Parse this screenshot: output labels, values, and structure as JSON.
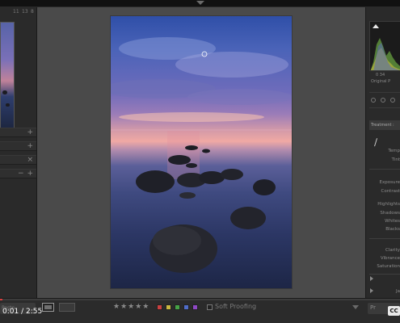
{
  "top_bar": {
    "collapse_icon": "triangle-down-icon"
  },
  "navigator": {
    "zoom_options": [
      "11",
      "13",
      "8"
    ]
  },
  "left_panel": {
    "rows": [
      {
        "action": "+"
      },
      {
        "action": "+"
      },
      {
        "action": "×"
      },
      {
        "action_minus": "−",
        "action": "+"
      }
    ],
    "paste_label": "Paste"
  },
  "histogram": {
    "iso_text": "0 34",
    "original_photo_label": "Original P"
  },
  "right_panel": {
    "treatment_label": "Treatment :",
    "basic_labels": [
      "Temp",
      "Tint"
    ],
    "tone_labels": [
      "Exposure",
      "Contrast",
      "Highlights",
      "Shadows",
      "Whites",
      "Blacks"
    ],
    "presence_labels": [
      "Clarity",
      "Vibrance",
      "Saturation"
    ],
    "bottom_label": "Ja",
    "previous_label": "Pr"
  },
  "toolbar": {
    "stars": "★★★★★",
    "color_labels": [
      "#c94040",
      "#c9b740",
      "#46a346",
      "#4f6cc9",
      "#8e48c4"
    ],
    "soft_proofing_label": "Soft Proofing"
  },
  "video": {
    "time": "0:01 / 2:55",
    "progress": 0.006,
    "cc_label": "CC"
  }
}
